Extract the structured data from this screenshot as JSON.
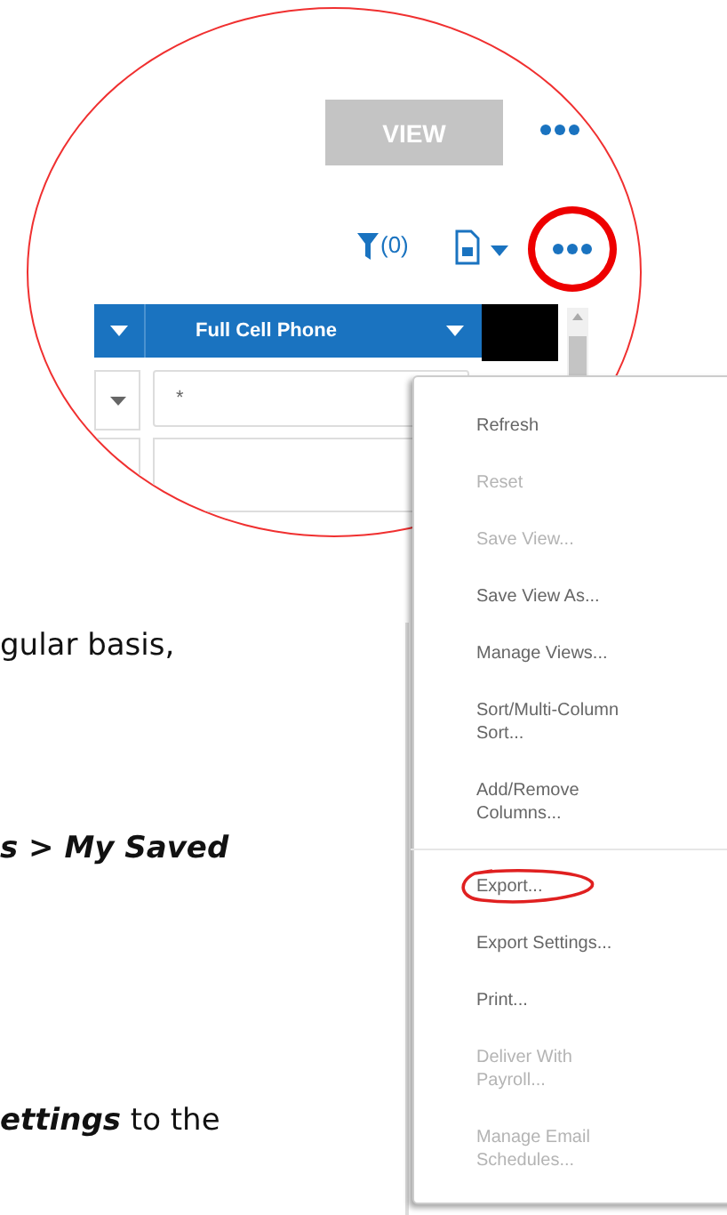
{
  "document": {
    "lines": [
      [
        {
          "text": "gular basis,",
          "emphasis": false
        }
      ],
      [
        {
          "text": "s > My Saved",
          "emphasis": true
        }
      ],
      [
        {
          "text": "ettings",
          "emphasis": true
        },
        {
          "text": " to the",
          "emphasis": false
        }
      ]
    ]
  },
  "zoom_view": {
    "view_button": "VIEW",
    "filter_count": "(0)",
    "columns": [
      {
        "label": "Full Cell Phone"
      }
    ],
    "filter_row": {
      "value": "*"
    }
  },
  "menu": {
    "items": [
      {
        "kind": "item",
        "label": "Refresh",
        "disabled": false,
        "circled": false
      },
      {
        "kind": "item",
        "label": "Reset",
        "disabled": true,
        "circled": false
      },
      {
        "kind": "item",
        "label": "Save View...",
        "disabled": true,
        "circled": false
      },
      {
        "kind": "item",
        "label": "Save View As...",
        "disabled": false,
        "circled": false
      },
      {
        "kind": "item",
        "label": "Manage Views...",
        "disabled": false,
        "circled": false
      },
      {
        "kind": "item",
        "label": "Sort/Multi-Column Sort...",
        "disabled": false,
        "circled": false
      },
      {
        "kind": "item",
        "label": "Add/Remove Columns...",
        "disabled": false,
        "circled": false
      },
      {
        "kind": "separator"
      },
      {
        "kind": "item",
        "label": "Export...",
        "disabled": false,
        "circled": true
      },
      {
        "kind": "item",
        "label": "Export Settings...",
        "disabled": false,
        "circled": false
      },
      {
        "kind": "item",
        "label": "Print...",
        "disabled": false,
        "circled": false
      },
      {
        "kind": "item",
        "label": "Deliver With Payroll...",
        "disabled": true,
        "circled": false
      },
      {
        "kind": "item",
        "label": "Manage Email Schedules...",
        "disabled": true,
        "circled": false
      }
    ]
  }
}
